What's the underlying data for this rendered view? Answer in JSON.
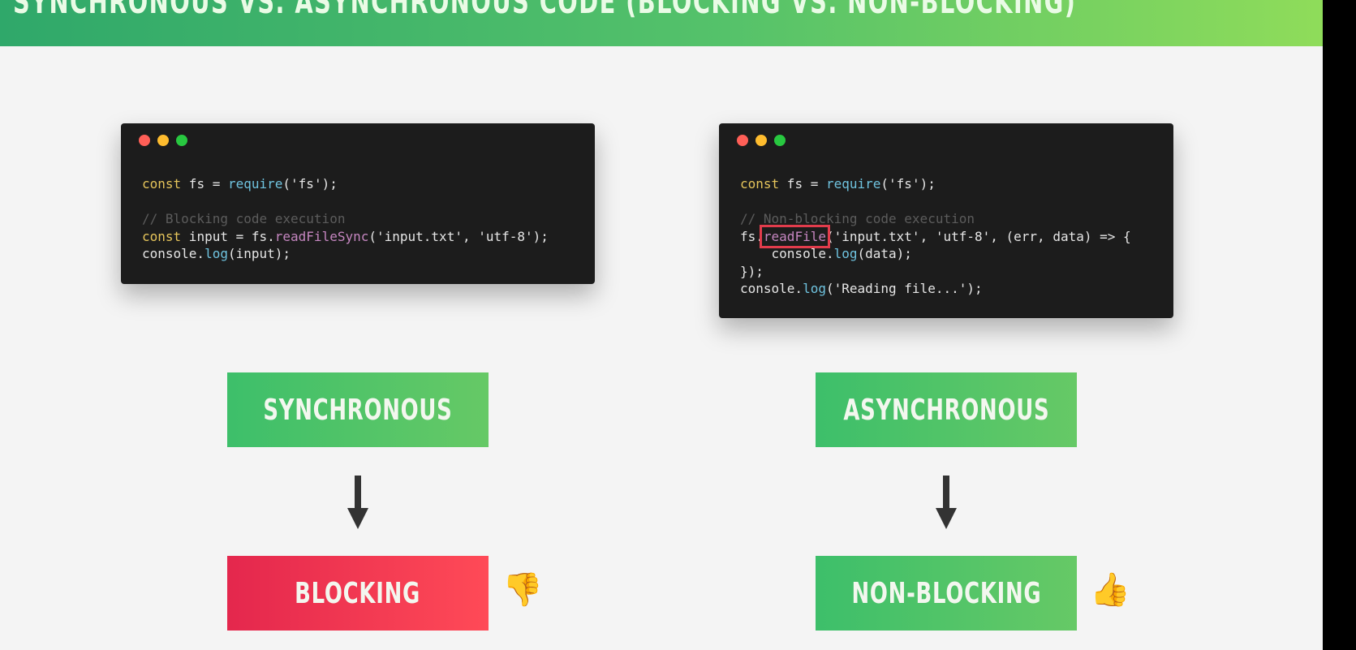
{
  "header": {
    "title": "SYNCHRONOUS VS. ASYNCHRONOUS CODE (BLOCKING VS. NON-BLOCKING)"
  },
  "left_code": {
    "line1": {
      "kw": "const",
      "rest1": " fs = ",
      "fn": "require",
      "rest2": "('fs');"
    },
    "comment": "// Blocking code execution",
    "line3": {
      "kw": "const",
      "rest1": " input = fs.",
      "fn": "readFileSync",
      "rest2": "('input.txt', 'utf-8');"
    },
    "line4": {
      "a": "console.",
      "fn": "log",
      "b": "(input);"
    }
  },
  "right_code": {
    "line1": {
      "kw": "const",
      "rest1": " fs = ",
      "fn": "require",
      "rest2": "('fs');"
    },
    "comment": "// Non-blocking code execution",
    "line3": {
      "a": "fs.",
      "fn": "readFile",
      "b": "('input.txt', 'utf-8', (err, data) => {"
    },
    "line4": {
      "a": "    console.",
      "fn": "log",
      "b": "(data);"
    },
    "line5": "});",
    "line6": {
      "a": "console.",
      "fn": "log",
      "b": "('Reading file...');"
    }
  },
  "labels": {
    "synchronous": "SYNCHRONOUS",
    "asynchronous": "ASYNCHRONOUS",
    "blocking": "BLOCKING",
    "non_blocking": "NON-BLOCKING"
  },
  "icons": {
    "thumb_down": "👎",
    "thumb_up": "👍"
  },
  "colors": {
    "green": "#4ec26a",
    "red": "#f0364f",
    "code_bg": "#1c1c1c",
    "highlight": "#e23c4c"
  }
}
